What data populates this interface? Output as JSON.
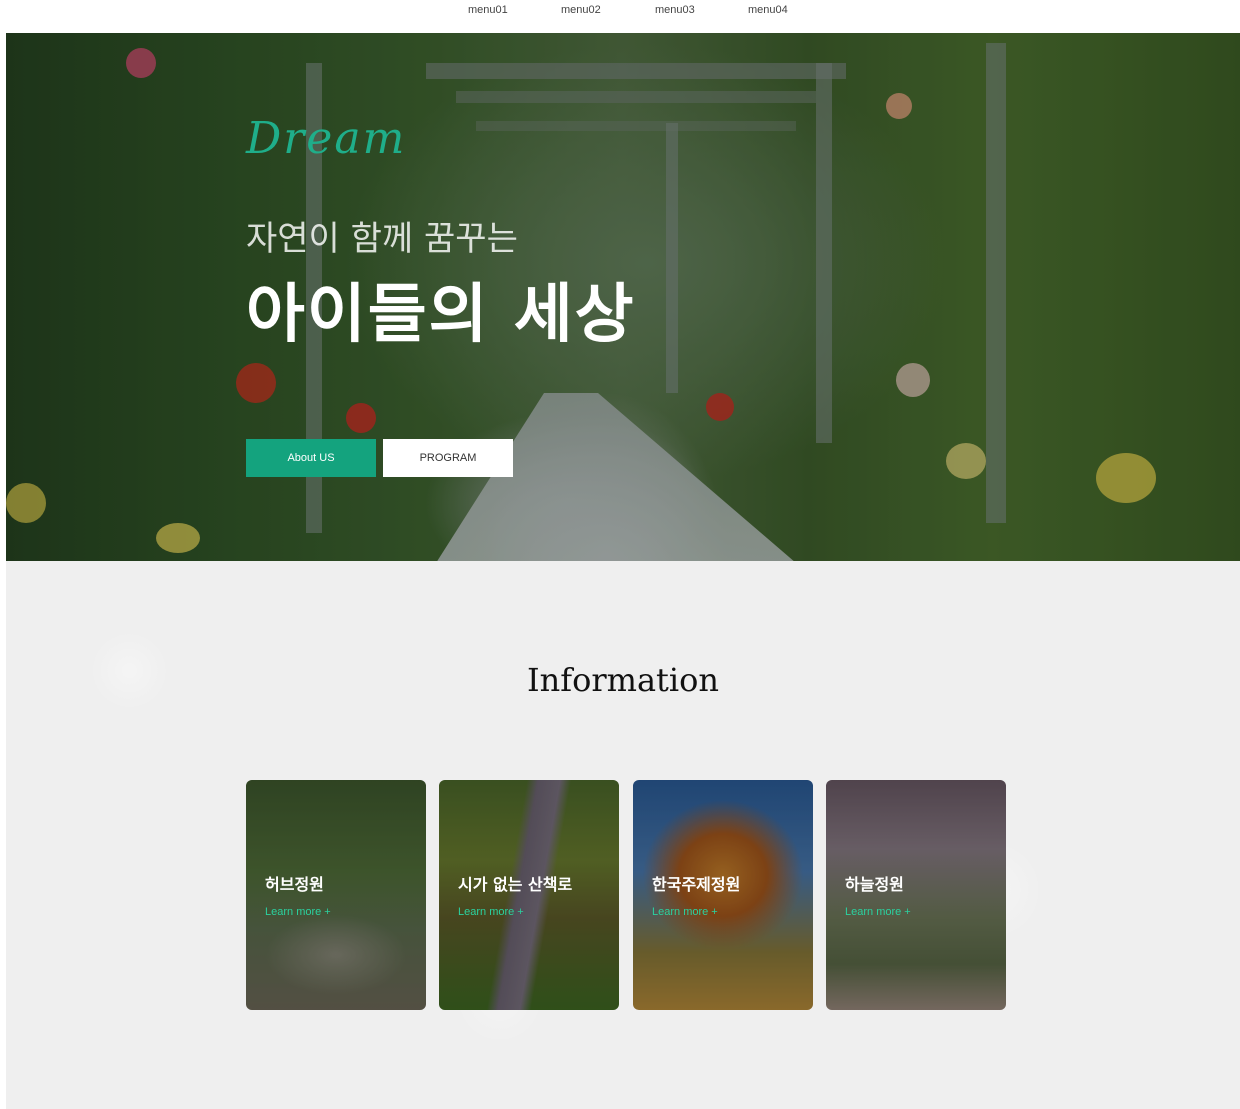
{
  "nav": {
    "items": [
      "menu01",
      "menu02",
      "menu03",
      "menu04"
    ]
  },
  "hero": {
    "brand": "Dream",
    "subline": "자연이 함께 꿈꾸는",
    "headline": "아이들의 세상",
    "buttons": {
      "about": "About US",
      "program": "PROGRAM"
    }
  },
  "info": {
    "title": "Information",
    "cards": [
      {
        "title": "허브정원",
        "link": "Learn more +"
      },
      {
        "title": "시가 없는 산책로",
        "link": "Learn more +"
      },
      {
        "title": "한국주제정원",
        "link": "Learn more +"
      },
      {
        "title": "하늘정원",
        "link": "Learn more +"
      }
    ]
  },
  "colors": {
    "accent": "#14a37e",
    "brand": "#1fae8a",
    "link": "#2bd19f",
    "section_bg": "#efefef"
  }
}
